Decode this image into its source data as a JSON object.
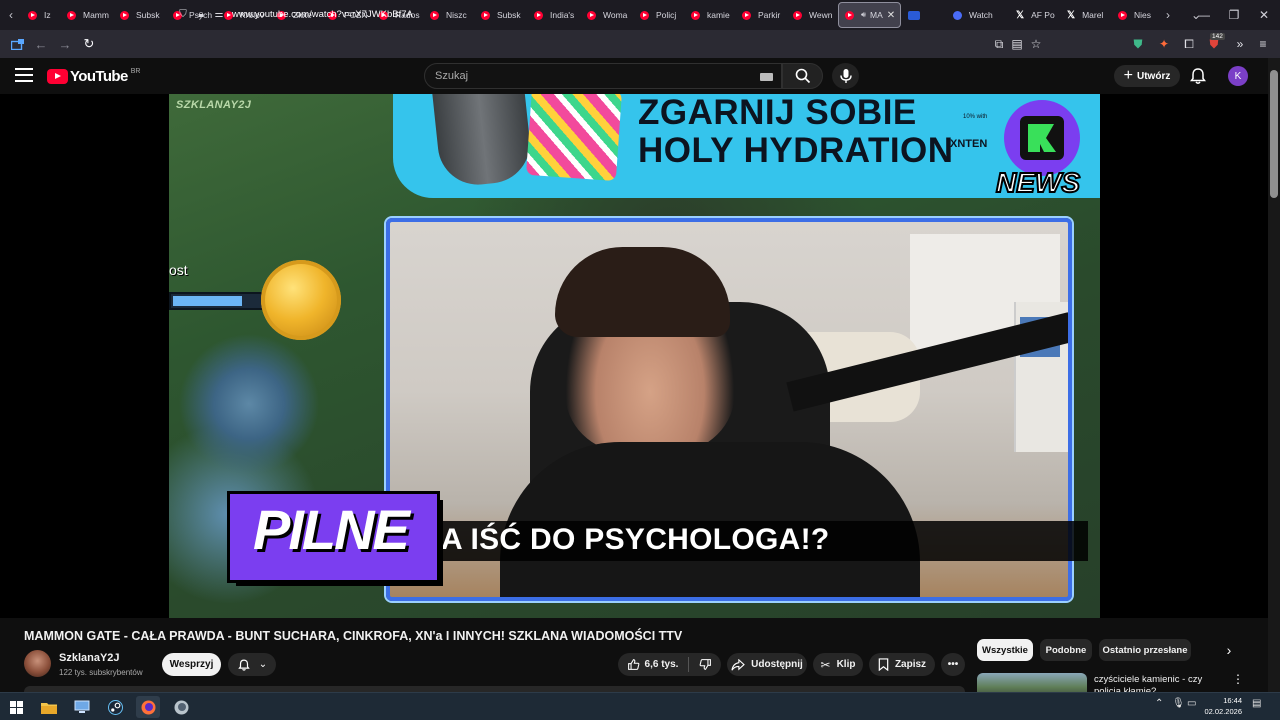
{
  "browser": {
    "tabs": [
      {
        "label": "Iz",
        "icon": "youtube-icon"
      },
      {
        "label": "Mamm",
        "icon": "youtube-icon"
      },
      {
        "label": "Subsk",
        "icon": "youtube-icon"
      },
      {
        "label": "Psych",
        "icon": "youtube-icon"
      },
      {
        "label": "Królov",
        "icon": "youtube-icon"
      },
      {
        "label": "Złote",
        "icon": "youtube-icon"
      },
      {
        "label": "POZN",
        "icon": "youtube-icon"
      },
      {
        "label": "Rados",
        "icon": "youtube-icon"
      },
      {
        "label": "Niszc",
        "icon": "youtube-icon"
      },
      {
        "label": "Subsk",
        "icon": "youtube-icon"
      },
      {
        "label": "India's",
        "icon": "youtube-icon"
      },
      {
        "label": "Woma",
        "icon": "youtube-icon"
      },
      {
        "label": "Policj",
        "icon": "youtube-icon"
      },
      {
        "label": "kamie",
        "icon": "youtube-icon"
      },
      {
        "label": "Parkir",
        "icon": "youtube-icon"
      },
      {
        "label": "Wewn",
        "icon": "youtube-icon"
      },
      {
        "label": "MA",
        "icon": "youtube-icon",
        "active": true
      },
      {
        "label": "",
        "icon": "flag-icon"
      },
      {
        "label": "Watch",
        "icon": "meet-icon"
      },
      {
        "label": "AF Po",
        "icon": "x-icon"
      },
      {
        "label": "Marel",
        "icon": "x-icon"
      },
      {
        "label": "Nies",
        "icon": "youtube-icon"
      }
    ],
    "url": "www.youtube.com/watch?v=rX7JWKbBf7A",
    "badge_count": "142"
  },
  "youtube": {
    "logo": "YouTube",
    "country": "BR",
    "search_placeholder": "Szukaj",
    "create_label": "Utwórz",
    "avatar_letter": "K"
  },
  "video": {
    "frame_texts": {
      "channel_tag": "SZKLANAY2J",
      "ost": "ost",
      "ad_headline_1": "ZGARNIJ SOBIE",
      "ad_headline_2": "HOLY HYDRATION",
      "ad_small": "10% with",
      "ad_side": "XNTEN",
      "logo_news": "NEWS",
      "subtitle": "A IŚĆ DO PSYCHOLOGA!?",
      "pilne": "PILNE"
    },
    "health_fraction": 0.72,
    "title": "MAMMON GATE - CAŁA PRAWDA - BUNT SUCHARA, CINKROFA, XN'a I INNYCH! SZKLANA WIADOMOŚCI TTV",
    "channel": "SzklanaY2J",
    "subscribers": "122 tys. subskrybentów",
    "support_label": "Wesprzyj",
    "likes": "6,6 tys.",
    "share_label": "Udostępnij",
    "clip_label": "Klip",
    "save_label": "Zapisz"
  },
  "sidebar": {
    "chips": [
      "Wszystkie",
      "Podobne",
      "Ostatnio przesłane"
    ],
    "recommended": {
      "title": "czyściciele kamienic - czy policja kłamie?"
    }
  },
  "taskbar": {
    "apps": [
      "windows-start-icon",
      "file-explorer-icon",
      "monitor-icon",
      "steam-icon",
      "firefox-icon",
      "firefox-alt-icon"
    ],
    "time": "16:44",
    "date": "02.02.2026"
  }
}
